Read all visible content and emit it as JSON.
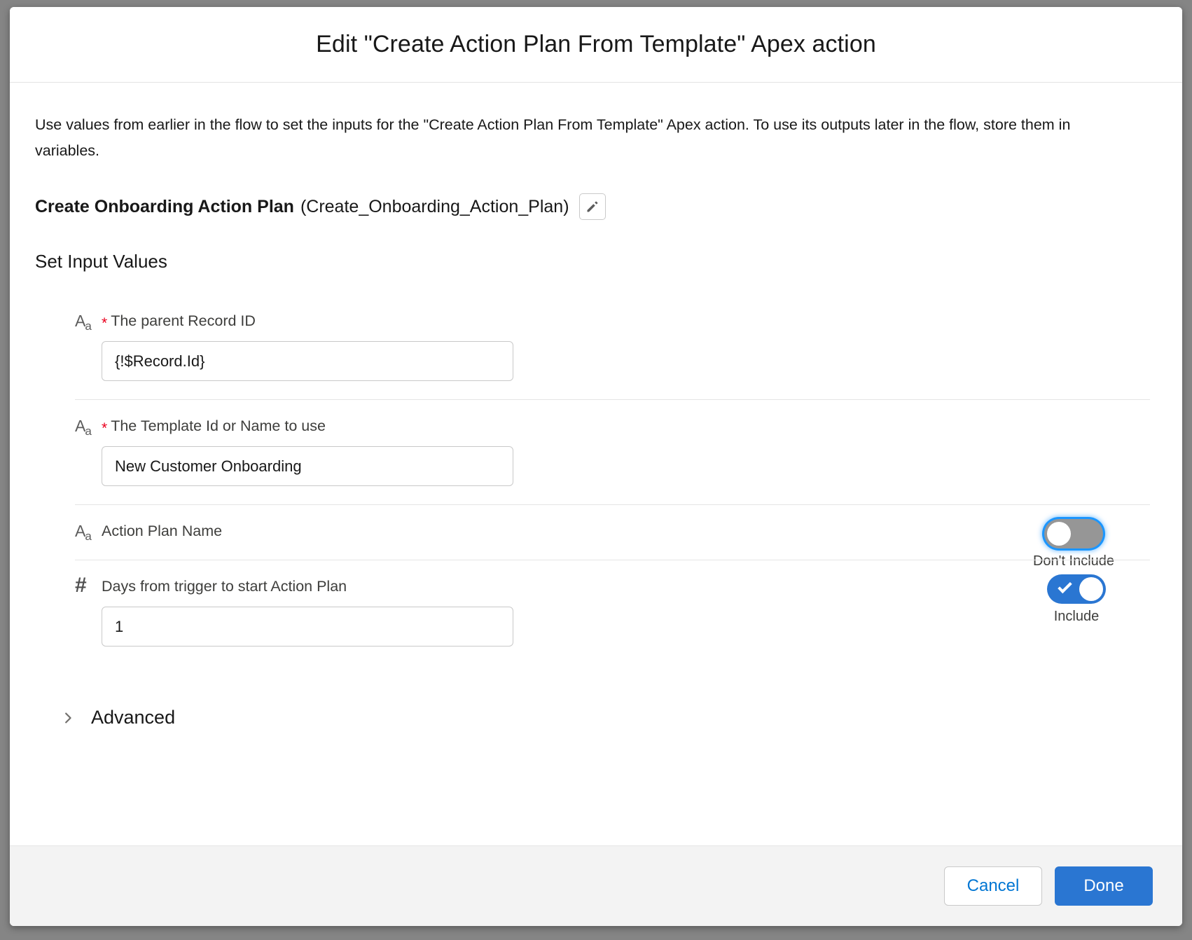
{
  "modal": {
    "title": "Edit \"Create Action Plan From Template\" Apex action",
    "description": "Use values from earlier in the flow to set the inputs for the \"Create Action Plan From Template\" Apex action. To use its outputs later in the flow, store them in variables.",
    "element_label": "Create Onboarding Action Plan",
    "element_api_name": "(Create_Onboarding_Action_Plan)",
    "edit_name_icon": "pencil-icon",
    "section_heading": "Set Input Values"
  },
  "inputs": [
    {
      "type_icon": "text-type-icon",
      "icon_glyph": "A",
      "icon_sub": "a",
      "required": true,
      "required_marker": "*",
      "label": "The parent Record ID",
      "value": "{!$Record.Id}",
      "placeholder": "",
      "has_toggle": false,
      "toggle_label": "",
      "toggle_on": false
    },
    {
      "type_icon": "text-type-icon",
      "icon_glyph": "A",
      "icon_sub": "a",
      "required": true,
      "required_marker": "*",
      "label": "The Template Id or Name to use",
      "value": "New Customer Onboarding",
      "placeholder": "",
      "has_toggle": false,
      "toggle_label": "",
      "toggle_on": false
    },
    {
      "type_icon": "text-type-icon",
      "icon_glyph": "A",
      "icon_sub": "a",
      "required": false,
      "required_marker": "",
      "label": "Action Plan Name",
      "value": null,
      "placeholder": "",
      "has_toggle": true,
      "toggle_label": "Don't Include",
      "toggle_on": false,
      "toggle_focused": true
    },
    {
      "type_icon": "number-type-icon",
      "icon_glyph": "#",
      "icon_sub": "",
      "required": false,
      "required_marker": "",
      "label": "Days from trigger to start Action Plan",
      "value": "1",
      "placeholder": "",
      "has_toggle": true,
      "toggle_label": "Include",
      "toggle_on": true,
      "toggle_focused": false
    }
  ],
  "advanced": {
    "label": "Advanced",
    "expanded": false,
    "chevron_icon": "chevron-right-icon"
  },
  "footer": {
    "cancel_label": "Cancel",
    "done_label": "Done"
  },
  "colors": {
    "brand_blue": "#2a76d2",
    "link_blue": "#0176d3",
    "required_red": "#ea001e",
    "toggle_off_gray": "#969696",
    "footer_bg": "#f3f3f3",
    "backdrop": "#858585"
  }
}
